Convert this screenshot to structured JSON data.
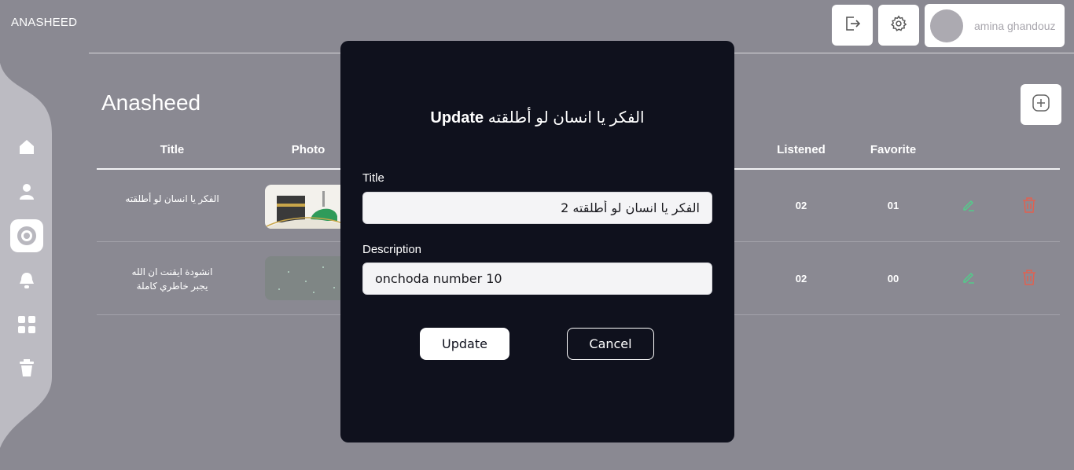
{
  "app": {
    "brand": "ANASHEED"
  },
  "sidebar": {
    "items": [
      {
        "icon": "home-icon",
        "active": false
      },
      {
        "icon": "user-icon",
        "active": false
      },
      {
        "icon": "disc-icon",
        "active": true
      },
      {
        "icon": "bell-icon",
        "active": false
      },
      {
        "icon": "grid-icon",
        "active": false
      },
      {
        "icon": "trash-icon",
        "active": false
      }
    ]
  },
  "header": {
    "logout_icon": "logout-icon",
    "settings_icon": "gear-icon",
    "profile_name": "amina ghandouz"
  },
  "page": {
    "title": "Anasheed",
    "add_icon": "add-square-icon"
  },
  "table": {
    "columns": [
      "Title",
      "Photo",
      "Listened",
      "Favorite"
    ],
    "rows": [
      {
        "title": "الفكر يا انسان لو أطلقته",
        "photo": "kaaba-thumbnail",
        "listened": "02",
        "favorite": "01"
      },
      {
        "title": "انشودة ايقنت ان الله يجبر خاطري كاملة",
        "photo": "green-sparkle-thumbnail",
        "listened": "02",
        "favorite": "00"
      }
    ],
    "edit_icon": "edit-pencil-icon",
    "delete_icon": "trash-icon"
  },
  "modal": {
    "title_strong": "Update",
    "title_name": "الفكر يا انسان لو أطلقته",
    "title_label": "Title",
    "title_value": "الفكر يا انسان لو أطلقته 2",
    "description_label": "Description",
    "description_value": "onchoda number 10",
    "update_button": "Update",
    "cancel_button": "Cancel"
  },
  "colors": {
    "background": "#8a8992",
    "modal": "#0f111d",
    "edit": "#4fd08a",
    "delete": "#e2604f"
  }
}
